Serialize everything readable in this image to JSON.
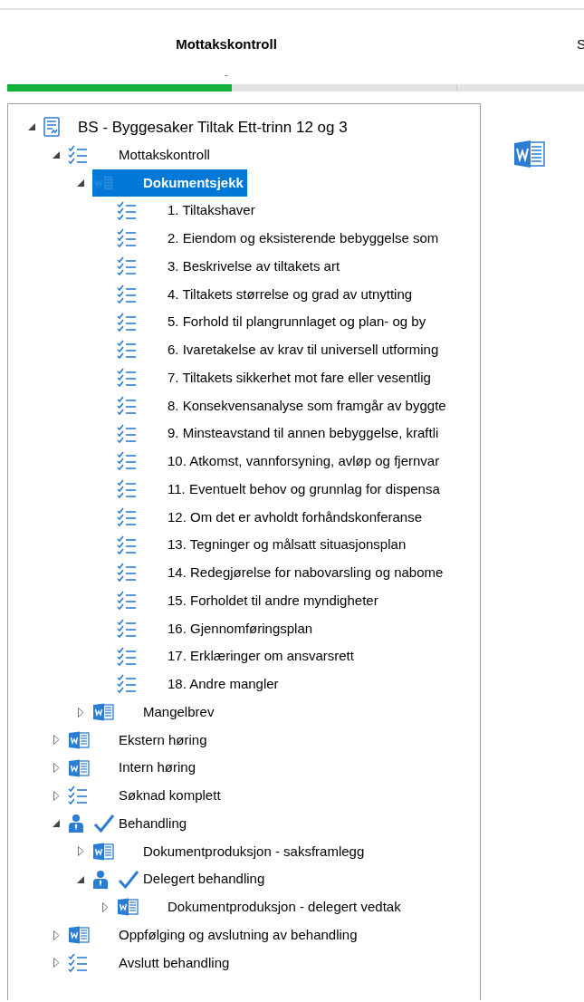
{
  "header": {
    "title": "Mottakskontroll",
    "subtitle": "-",
    "next_title": "S"
  },
  "progress": {
    "level": 0.5
  },
  "tree": [
    {
      "label": "BS - Byggesaker Tiltak Ett-trinn 12 og 3",
      "kind": "case",
      "expanded": true,
      "selected": false,
      "children": [
        {
          "label": "Mottakskontroll",
          "kind": "checklist",
          "expanded": true,
          "selected": false,
          "children": [
            {
              "label": "Dokumentsjekk",
              "kind": "document",
              "expanded": true,
              "selected": true,
              "children": [
                {
                  "label": "1. Tiltakshaver",
                  "kind": "checklist",
                  "selected": false
                },
                {
                  "label": "2. Eiendom og eksisterende bebyggelse som",
                  "kind": "checklist",
                  "selected": false
                },
                {
                  "label": "3. Beskrivelse av tiltakets art",
                  "kind": "checklist",
                  "selected": false
                },
                {
                  "label": "4. Tiltakets størrelse og grad av utnytting",
                  "kind": "checklist",
                  "selected": false
                },
                {
                  "label": "5. Forhold til plangrunnlaget og plan- og by",
                  "kind": "checklist",
                  "selected": false
                },
                {
                  "label": "6. Ivaretakelse av krav til universell utforming",
                  "kind": "checklist",
                  "selected": false
                },
                {
                  "label": "7. Tiltakets sikkerhet mot fare eller vesentlig",
                  "kind": "checklist",
                  "selected": false
                },
                {
                  "label": "8. Konsekvensanalyse som framgår av byggte",
                  "kind": "checklist",
                  "selected": false
                },
                {
                  "label": "9. Minsteavstand til annen bebyggelse, kraftli",
                  "kind": "checklist",
                  "selected": false
                },
                {
                  "label": "10. Atkomst, vannforsyning, avløp og fjernvar",
                  "kind": "checklist",
                  "selected": false
                },
                {
                  "label": "11. Eventuelt behov og grunnlag for dispensa",
                  "kind": "checklist",
                  "selected": false
                },
                {
                  "label": "12. Om det er avholdt forhåndskonferanse",
                  "kind": "checklist",
                  "selected": false
                },
                {
                  "label": "13. Tegninger og målsatt situasjonsplan",
                  "kind": "checklist",
                  "selected": false
                },
                {
                  "label": "14. Redegjørelse for nabovarsling og nabome",
                  "kind": "checklist",
                  "selected": false
                },
                {
                  "label": "15. Forholdet til andre myndigheter",
                  "kind": "checklist",
                  "selected": false
                },
                {
                  "label": "16. Gjennomføringsplan",
                  "kind": "checklist",
                  "selected": false
                },
                {
                  "label": "17. Erklæringer om ansvarsrett",
                  "kind": "checklist",
                  "selected": false
                },
                {
                  "label": "18. Andre mangler",
                  "kind": "checklist",
                  "selected": false
                }
              ]
            },
            {
              "label": "Mangelbrev",
              "kind": "document",
              "expanded": false,
              "selected": false
            }
          ]
        },
        {
          "label": "Ekstern høring",
          "kind": "document",
          "expanded": false,
          "selected": false
        },
        {
          "label": "Intern høring",
          "kind": "document",
          "expanded": false,
          "selected": false
        },
        {
          "label": "Søknad komplett",
          "kind": "checklist",
          "expanded": false,
          "selected": false
        },
        {
          "label": "Behandling",
          "kind": "task",
          "done": true,
          "expanded": true,
          "selected": false,
          "children": [
            {
              "label": "Dokumentproduksjon - saksframlegg",
              "kind": "document",
              "expanded": false,
              "selected": false
            },
            {
              "label": "Delegert behandling",
              "kind": "task",
              "done": true,
              "expanded": true,
              "selected": false,
              "children": [
                {
                  "label": "Dokumentproduksjon - delegert vedtak",
                  "kind": "document",
                  "expanded": false,
                  "selected": false
                }
              ]
            }
          ]
        },
        {
          "label": "Oppfølging og avslutning av behandling",
          "kind": "document",
          "expanded": false,
          "selected": false
        },
        {
          "label": "Avslutt behandling",
          "kind": "checklist",
          "expanded": false,
          "selected": false
        }
      ]
    }
  ]
}
